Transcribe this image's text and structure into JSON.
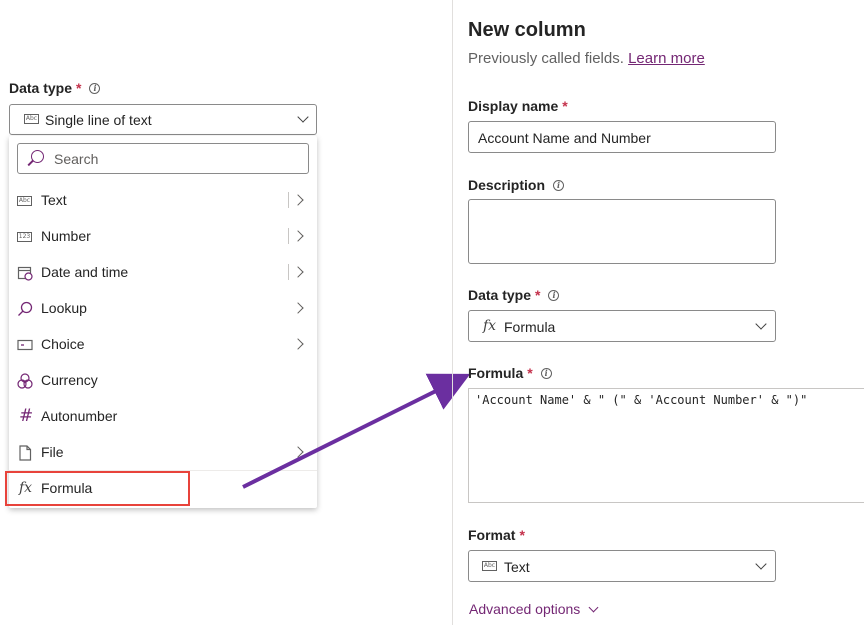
{
  "left": {
    "data_type_label": "Data type",
    "required_mark": "*",
    "selected": "Single line of text",
    "search_placeholder": "Search",
    "items": [
      {
        "label": "Text",
        "icon": "abc-icon",
        "submenu": true
      },
      {
        "label": "Number",
        "icon": "number-icon",
        "submenu": true
      },
      {
        "label": "Date and time",
        "icon": "calendar-icon",
        "submenu": true
      },
      {
        "label": "Lookup",
        "icon": "search-icon",
        "submenu": true
      },
      {
        "label": "Choice",
        "icon": "choice-icon",
        "submenu": true
      },
      {
        "label": "Currency",
        "icon": "currency-icon",
        "submenu": false
      },
      {
        "label": "Autonumber",
        "icon": "hash-icon",
        "submenu": false
      },
      {
        "label": "File",
        "icon": "file-icon",
        "submenu": true
      },
      {
        "label": "Formula",
        "icon": "fx-icon",
        "submenu": false
      }
    ]
  },
  "panel": {
    "title": "New column",
    "subtitle": "Previously called fields.",
    "learn_more": "Learn more",
    "display_name_label": "Display name",
    "display_name_value": "Account Name and Number",
    "description_label": "Description",
    "description_value": "",
    "data_type_label": "Data type",
    "data_type_value": "Formula",
    "formula_label": "Formula",
    "formula_value": "'Account Name' & \" (\" & 'Account Number' & \")\"",
    "format_label": "Format",
    "format_value": "Text",
    "advanced_options": "Advanced options"
  },
  "icons": {
    "fx": "fx",
    "abc": "Abc",
    "num": "123"
  },
  "colors": {
    "accent": "#742774",
    "highlight": "#e8433b",
    "arrow": "#6b2fa0"
  }
}
